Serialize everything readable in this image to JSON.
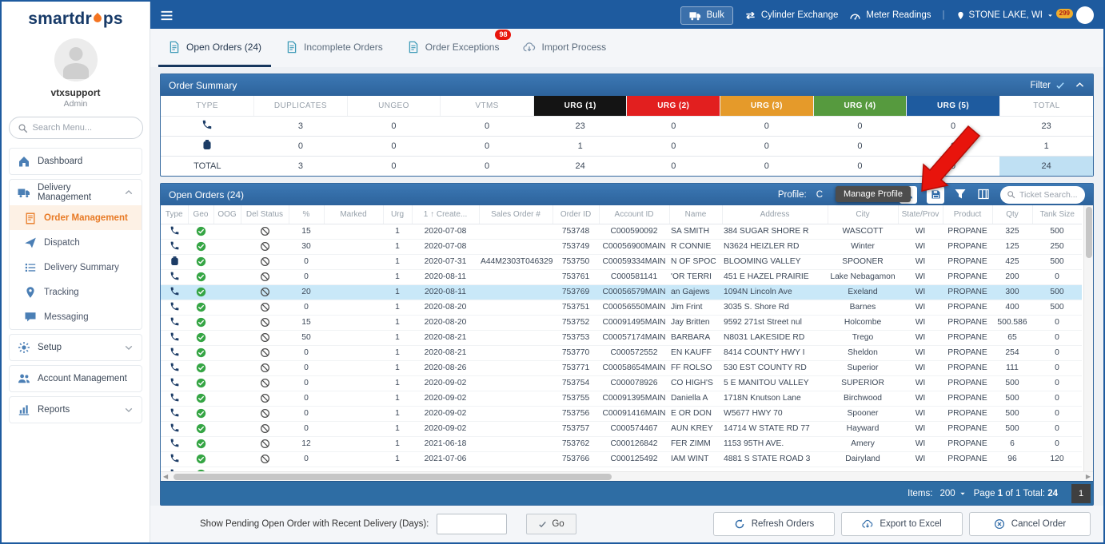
{
  "colors": {
    "header_blue": "#1e5b9f",
    "panel_blue": "#2f6ba8",
    "accent_orange": "#f47421",
    "selected_row": "#c9e8f8",
    "badge_red": "#e8140c",
    "geo_green": "#35a544",
    "urg1": "#141414",
    "urg2": "#e21f1f",
    "urg3": "#e59a2a",
    "urg4": "#569a3e",
    "urg5": "#1e5b9f"
  },
  "sidebar": {
    "logo_pre": "smartdr",
    "logo_post": "ps",
    "user_name": "vtxsupport",
    "user_role": "Admin",
    "search_placeholder": "Search Menu...",
    "nav": [
      {
        "label": "Dashboard",
        "icon": "home",
        "kind": "top"
      },
      {
        "label": "Delivery Management",
        "icon": "truck",
        "kind": "group-open",
        "children": [
          {
            "label": "Order Management",
            "icon": "clipboard",
            "active": true
          },
          {
            "label": "Dispatch",
            "icon": "plane"
          },
          {
            "label": "Delivery Summary",
            "icon": "list"
          },
          {
            "label": "Tracking",
            "icon": "pin"
          },
          {
            "label": "Messaging",
            "icon": "chat"
          }
        ]
      },
      {
        "label": "Setup",
        "icon": "gear",
        "kind": "group-closed"
      },
      {
        "label": "Account Management",
        "icon": "users",
        "kind": "top"
      },
      {
        "label": "Reports",
        "icon": "report",
        "kind": "group-closed"
      }
    ]
  },
  "topbar": {
    "menu": [
      {
        "label": "Bulk",
        "icon": "truck",
        "boxed": true
      },
      {
        "label": "Cylinder Exchange",
        "icon": "exchange"
      },
      {
        "label": "Meter Readings",
        "icon": "meter"
      }
    ],
    "location_label": "STONE LAKE, WI",
    "bell_badge": "299"
  },
  "tabs": [
    {
      "label": "Open Orders (24)",
      "icon": "doc",
      "active": true
    },
    {
      "label": "Incomplete Orders",
      "icon": "doc"
    },
    {
      "label": "Order Exceptions",
      "icon": "doc",
      "badge": "98"
    },
    {
      "label": "Import Process",
      "icon": "cloud"
    }
  ],
  "summary": {
    "title": "Order Summary",
    "filter_label": "Filter",
    "headers": [
      {
        "label": "TYPE"
      },
      {
        "label": "DUPLICATES"
      },
      {
        "label": "UNGEO"
      },
      {
        "label": "VTMS"
      },
      {
        "label": "URG (1)",
        "bg": "#141414"
      },
      {
        "label": "URG (2)",
        "bg": "#e21f1f"
      },
      {
        "label": "URG (3)",
        "bg": "#e59a2a"
      },
      {
        "label": "URG (4)",
        "bg": "#569a3e"
      },
      {
        "label": "URG (5)",
        "bg": "#1e5b9f"
      },
      {
        "label": "TOTAL"
      }
    ],
    "rows": [
      {
        "type": "phone",
        "cells": [
          "3",
          "0",
          "0",
          "23",
          "0",
          "0",
          "0",
          "0",
          "23"
        ]
      },
      {
        "type": "tank",
        "cells": [
          "0",
          "0",
          "0",
          "1",
          "0",
          "0",
          "0",
          "0",
          "1"
        ]
      },
      {
        "type": "TOTAL",
        "label": "TOTAL",
        "cells": [
          "3",
          "0",
          "0",
          "24",
          "0",
          "0",
          "0",
          "0",
          "24"
        ],
        "is_total": true
      }
    ]
  },
  "orders": {
    "title": "Open Orders (24)",
    "profile_label": "Profile:",
    "profile_value": "C",
    "tooltip": "Manage Profile",
    "search_placeholder": "Ticket Search...",
    "columns": [
      "Type",
      "Geo",
      "OOG",
      "Del Status",
      "%",
      "Marked",
      "Urg",
      "1 ↑ Create...",
      "Sales Order #",
      "Order ID",
      "Account ID",
      "Name",
      "Address",
      "City",
      "State/Prov",
      "Product",
      "Qty",
      "Tank Size"
    ],
    "selected_index": 4,
    "rows": [
      {
        "type": "phone",
        "geo": "check",
        "del": "block",
        "pct": "15",
        "urg": "1",
        "created": "2020-07-08",
        "sales": "",
        "order_id": "753748",
        "account": "C000590092",
        "name": "SA SMITH",
        "address": "384 SUGAR SHORE R",
        "city": "WASCOTT",
        "state": "WI",
        "product": "PROPANE",
        "qty": "325",
        "tank": "500"
      },
      {
        "type": "phone",
        "geo": "check",
        "del": "block",
        "pct": "30",
        "urg": "1",
        "created": "2020-07-08",
        "sales": "",
        "order_id": "753749",
        "account": "C00056900MAIN",
        "name": "R CONNIE",
        "address": "N3624 HEIZLER RD",
        "city": "Winter",
        "state": "WI",
        "product": "PROPANE",
        "qty": "125",
        "tank": "250"
      },
      {
        "type": "tank",
        "geo": "check",
        "del": "block",
        "pct": "0",
        "urg": "1",
        "created": "2020-07-31",
        "sales": "A44M2303T046329",
        "order_id": "753750",
        "account": "C00059334MAIN",
        "name": "N OF SPOC",
        "address": "BLOOMING VALLEY",
        "city": "SPOONER",
        "state": "WI",
        "product": "PROPANE",
        "qty": "425",
        "tank": "500"
      },
      {
        "type": "phone",
        "geo": "check",
        "del": "block",
        "pct": "0",
        "urg": "1",
        "created": "2020-08-11",
        "sales": "",
        "order_id": "753761",
        "account": "C000581141",
        "name": "'OR TERRI",
        "address": "451 E HAZEL PRAIRIE",
        "city": "Lake Nebagamon",
        "state": "WI",
        "product": "PROPANE",
        "qty": "200",
        "tank": "0"
      },
      {
        "type": "phone",
        "geo": "check",
        "del": "block",
        "pct": "20",
        "urg": "1",
        "created": "2020-08-11",
        "sales": "",
        "order_id": "753769",
        "account": "C00056579MAIN",
        "name": "an Gajews",
        "address": "1094N Lincoln Ave",
        "city": "Exeland",
        "state": "WI",
        "product": "PROPANE",
        "qty": "300",
        "tank": "500"
      },
      {
        "type": "phone",
        "geo": "check",
        "del": "block",
        "pct": "0",
        "urg": "1",
        "created": "2020-08-20",
        "sales": "",
        "order_id": "753751",
        "account": "C00056550MAIN",
        "name": "Jim Frint",
        "address": "3035 S. Shore Rd",
        "city": "Barnes",
        "state": "WI",
        "product": "PROPANE",
        "qty": "400",
        "tank": "500"
      },
      {
        "type": "phone",
        "geo": "check",
        "del": "block",
        "pct": "15",
        "urg": "1",
        "created": "2020-08-20",
        "sales": "",
        "order_id": "753752",
        "account": "C00091495MAIN",
        "name": "Jay Britten",
        "address": "9592 271st Street nul",
        "city": "Holcombe",
        "state": "WI",
        "product": "PROPANE",
        "qty": "500.586",
        "tank": "0"
      },
      {
        "type": "phone",
        "geo": "check",
        "del": "block",
        "pct": "50",
        "urg": "1",
        "created": "2020-08-21",
        "sales": "",
        "order_id": "753753",
        "account": "C00057174MAIN",
        "name": "BARBARA",
        "address": "N8031 LAKESIDE RD",
        "city": "Trego",
        "state": "WI",
        "product": "PROPANE",
        "qty": "65",
        "tank": "0"
      },
      {
        "type": "phone",
        "geo": "check",
        "del": "block",
        "pct": "0",
        "urg": "1",
        "created": "2020-08-21",
        "sales": "",
        "order_id": "753770",
        "account": "C000572552",
        "name": "EN KAUFF",
        "address": "8414 COUNTY HWY I",
        "city": "Sheldon",
        "state": "WI",
        "product": "PROPANE",
        "qty": "254",
        "tank": "0"
      },
      {
        "type": "phone",
        "geo": "check",
        "del": "block",
        "pct": "0",
        "urg": "1",
        "created": "2020-08-26",
        "sales": "",
        "order_id": "753771",
        "account": "C00058654MAIN",
        "name": "FF ROLSO",
        "address": "530 EST COUNTY RD",
        "city": "Superior",
        "state": "WI",
        "product": "PROPANE",
        "qty": "111",
        "tank": "0"
      },
      {
        "type": "phone",
        "geo": "check",
        "del": "block",
        "pct": "0",
        "urg": "1",
        "created": "2020-09-02",
        "sales": "",
        "order_id": "753754",
        "account": "C000078926",
        "name": "CO HIGH'S",
        "address": "5 E MANITOU VALLEY",
        "city": "SUPERIOR",
        "state": "WI",
        "product": "PROPANE",
        "qty": "500",
        "tank": "0"
      },
      {
        "type": "phone",
        "geo": "check",
        "del": "block",
        "pct": "0",
        "urg": "1",
        "created": "2020-09-02",
        "sales": "",
        "order_id": "753755",
        "account": "C00091395MAIN",
        "name": "Daniella A",
        "address": "1718N Knutson Lane",
        "city": "Birchwood",
        "state": "WI",
        "product": "PROPANE",
        "qty": "500",
        "tank": "0"
      },
      {
        "type": "phone",
        "geo": "check",
        "del": "block",
        "pct": "0",
        "urg": "1",
        "created": "2020-09-02",
        "sales": "",
        "order_id": "753756",
        "account": "C00091416MAIN",
        "name": "E OR DON",
        "address": "W5677 HWY 70",
        "city": "Spooner",
        "state": "WI",
        "product": "PROPANE",
        "qty": "500",
        "tank": "0"
      },
      {
        "type": "phone",
        "geo": "check",
        "del": "block",
        "pct": "0",
        "urg": "1",
        "created": "2020-09-02",
        "sales": "",
        "order_id": "753757",
        "account": "C000574467",
        "name": "AUN KREY",
        "address": "14714 W STATE RD 77",
        "city": "Hayward",
        "state": "WI",
        "product": "PROPANE",
        "qty": "500",
        "tank": "0"
      },
      {
        "type": "phone",
        "geo": "check",
        "del": "block",
        "pct": "12",
        "urg": "1",
        "created": "2021-06-18",
        "sales": "",
        "order_id": "753762",
        "account": "C000126842",
        "name": "FER ZIMM",
        "address": "1153 95TH AVE.",
        "city": "Amery",
        "state": "WI",
        "product": "PROPANE",
        "qty": "6",
        "tank": "0"
      },
      {
        "type": "phone",
        "geo": "check",
        "del": "block",
        "pct": "0",
        "urg": "1",
        "created": "2021-07-06",
        "sales": "",
        "order_id": "753766",
        "account": "C000125492",
        "name": "IAM WINT",
        "address": "4881 S STATE ROAD 3",
        "city": "Dairyland",
        "state": "WI",
        "product": "PROPANE",
        "qty": "96",
        "tank": "120"
      },
      {
        "type": "phone",
        "geo": "check",
        "del": "",
        "pct": "",
        "urg": "",
        "created": "",
        "sales": "",
        "order_id": "",
        "account": "",
        "name": "",
        "address": "",
        "city": "",
        "state": "",
        "product": "",
        "qty": "",
        "tank": "",
        "partial": true
      }
    ]
  },
  "pagination": {
    "items_label": "Items:",
    "items_value": "200",
    "page_pre": "Page",
    "page_num": "1",
    "page_mid": "of 1",
    "total_label": "Total:",
    "total_value": "24",
    "page_button": "1"
  },
  "footer": {
    "pending_label": "Show Pending Open Order with Recent Delivery (Days):",
    "go_label": "Go",
    "actions": [
      {
        "label": "Refresh Orders",
        "icon": "refresh"
      },
      {
        "label": "Export to Excel",
        "icon": "cloud"
      },
      {
        "label": "Cancel Order",
        "icon": "cancel"
      }
    ]
  }
}
